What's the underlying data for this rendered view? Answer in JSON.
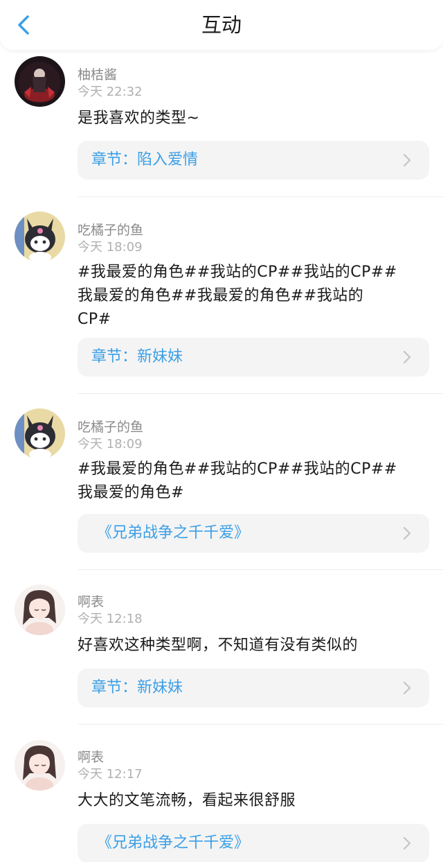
{
  "header": {
    "title": "互动",
    "back_icon": "chevron-left-icon"
  },
  "colors": {
    "accent": "#3b9fe6",
    "text_primary": "#1a1a1a",
    "text_secondary": "#8a8a8a",
    "text_tertiary": "#b0b0b0",
    "link_bg": "#f4f4f4"
  },
  "comments": [
    {
      "username": "柚桔酱",
      "time": "今天 22:32",
      "content_lines": [
        "是我喜欢的类型~"
      ],
      "link": "章节：陷入爱情"
    },
    {
      "username": "吃橘子的鱼",
      "time": "今天 18:09",
      "content_lines": [
        "#我最爱的角色##我站的CP##我站的CP##",
        "我最爱的角色##我最爱的角色##我站的",
        "CP#"
      ],
      "link": "章节：新妹妹"
    },
    {
      "username": "吃橘子的鱼",
      "time": "今天 18:09",
      "content_lines": [
        "#我最爱的角色##我站的CP##我站的CP##",
        "我最爱的角色#"
      ],
      "link": "《兄弟战争之千千爱》"
    },
    {
      "username": "啊表",
      "time": "今天 12:18",
      "content_lines": [
        "好喜欢这种类型啊，不知道有没有类似的"
      ],
      "link": "章节：新妹妹"
    },
    {
      "username": "啊表",
      "time": "今天 12:17",
      "content_lines": [
        "大大的文笔流畅，看起来很舒服"
      ],
      "link": "《兄弟战争之千千爱》"
    }
  ]
}
